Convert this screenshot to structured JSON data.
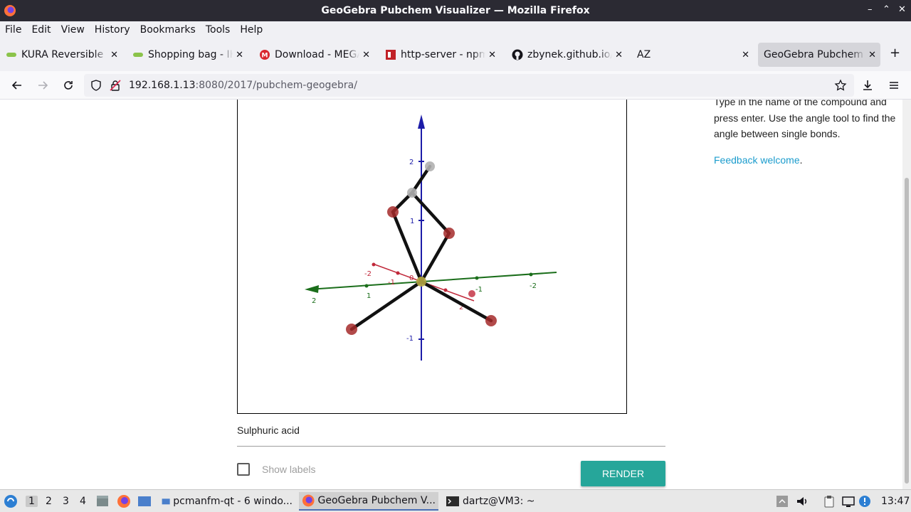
{
  "window": {
    "title": "GeoGebra Pubchem Visualizer — Mozilla Firefox",
    "controls": [
      "–",
      "⌃",
      "✕"
    ]
  },
  "menu": [
    "File",
    "Edit",
    "View",
    "History",
    "Bookmarks",
    "Tools",
    "Help"
  ],
  "tabs": [
    {
      "label": "KURA Reversible B",
      "icon": "kura-icon"
    },
    {
      "label": "Shopping bag - IKEA",
      "icon": "ikea-icon"
    },
    {
      "label": "Download - MEGA",
      "icon": "mega-icon"
    },
    {
      "label": "http-server - npm",
      "icon": "npm-icon"
    },
    {
      "label": "zbynek.github.io/ib",
      "icon": "github-icon"
    },
    {
      "label": "AZ",
      "icon": ""
    },
    {
      "label": "GeoGebra Pubchem Visualizer",
      "icon": ""
    }
  ],
  "new_tab": "+",
  "url": {
    "host": "192.168.1.13",
    "path": ":8080/2017/pubchem-geogebra/"
  },
  "sidebar": {
    "instructions": "Type in the name of the compound and press enter. Use the angle tool to find the angle between single bonds.",
    "feedback_link": "Feedback welcome",
    "feedback_suffix": "."
  },
  "graph": {
    "axis_labels": {
      "z_pos2": "2",
      "z_pos1": "1",
      "z_neg1": "-1",
      "x_neg2": "-2",
      "x_neg1": "-1",
      "x_pos2": "2",
      "x_0": "0",
      "y_pos2": "2",
      "y_pos1": "1",
      "y_neg1": "-1",
      "y_neg2": "-2"
    },
    "colors": {
      "z_axis": "#1c1ca8",
      "y_axis": "#1b6e1b",
      "x_axis": "#c0283a",
      "bond": "#111111",
      "oxygen": "#a52a2a",
      "hydrogen": "#b0b0b0",
      "sulfur": "#b5a642"
    }
  },
  "compound_input": "Sulphuric acid",
  "show_labels": "Show labels",
  "render_button": "RENDER",
  "taskbar": {
    "desktops": [
      "1",
      "2",
      "3",
      "4"
    ],
    "tasks": [
      "pcmanfm-qt - 6 windo...",
      "GeoGebra Pubchem V...",
      "dartz@VM3: ~"
    ],
    "clock": "13:47"
  }
}
